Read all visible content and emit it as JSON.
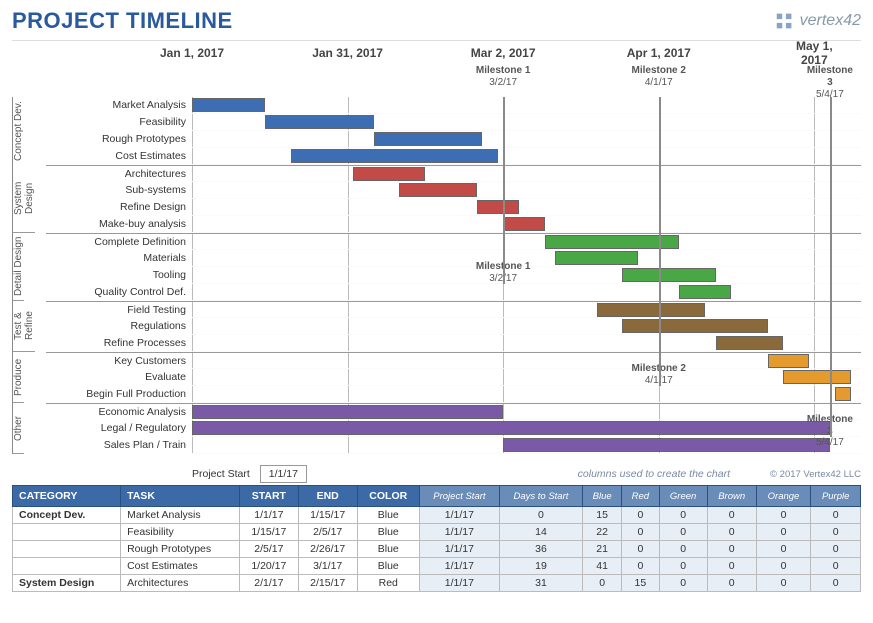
{
  "title": "PROJECT TIMELINE",
  "logo_text": "vertex42",
  "copyright": "© 2017 Vertex42 LLC",
  "project_start_label": "Project Start",
  "project_start_value": "1/1/17",
  "columns_hint": "columns used to create the chart",
  "colors": {
    "Blue": "#3d6db3",
    "Red": "#c24a47",
    "Green": "#4aa746",
    "Brown": "#8a6a3b",
    "Orange": "#e59a2e",
    "Purple": "#7a5aa6"
  },
  "chart_data": {
    "type": "gantt",
    "title": "PROJECT TIMELINE",
    "x_axis": {
      "start": "2017-01-01",
      "end": "2017-05-10",
      "ticks": [
        {
          "label": "Jan 1, 2017",
          "date": "2017-01-01"
        },
        {
          "label": "Jan 31, 2017",
          "date": "2017-01-31"
        },
        {
          "label": "Mar 2, 2017",
          "date": "2017-03-02"
        },
        {
          "label": "Apr 1, 2017",
          "date": "2017-04-01"
        },
        {
          "label": "May 1, 2017",
          "date": "2017-05-01"
        }
      ]
    },
    "milestones": [
      {
        "name": "Milestone 1",
        "date": "2017-03-02",
        "label": "3/2/17",
        "span_rows": [
          0,
          11
        ]
      },
      {
        "name": "Milestone 2",
        "date": "2017-04-01",
        "label": "4/1/17",
        "span_rows": [
          0,
          17
        ]
      },
      {
        "name": "Milestone 3",
        "date": "2017-05-04",
        "label": "5/4/17",
        "span_rows": [
          0,
          20
        ]
      }
    ],
    "milestone_callouts_lower": [
      {
        "name": "Milestone 1",
        "label": "3/2/17",
        "row_below": 10
      },
      {
        "name": "Milestone 2",
        "label": "4/1/17",
        "row_below": 16
      },
      {
        "name": "Milestone 3",
        "label": "5/4/17",
        "row_below": 19
      }
    ],
    "groups": [
      {
        "name": "Concept Dev.",
        "color": "Blue",
        "tasks": [
          {
            "name": "Market Analysis",
            "start": "2017-01-01",
            "end": "2017-01-15"
          },
          {
            "name": "Feasibility",
            "start": "2017-01-15",
            "end": "2017-02-05"
          },
          {
            "name": "Rough Prototypes",
            "start": "2017-02-05",
            "end": "2017-02-26"
          },
          {
            "name": "Cost Estimates",
            "start": "2017-01-20",
            "end": "2017-03-01"
          }
        ]
      },
      {
        "name": "System Design",
        "color": "Red",
        "tasks": [
          {
            "name": "Architectures",
            "start": "2017-02-01",
            "end": "2017-02-15"
          },
          {
            "name": "Sub-systems",
            "start": "2017-02-10",
            "end": "2017-02-25"
          },
          {
            "name": "Refine Design",
            "start": "2017-02-25",
            "end": "2017-03-05"
          },
          {
            "name": "Make-buy analysis",
            "start": "2017-03-02",
            "end": "2017-03-10"
          }
        ]
      },
      {
        "name": "Detail Design",
        "color": "Green",
        "tasks": [
          {
            "name": "Complete Definition",
            "start": "2017-03-10",
            "end": "2017-04-05"
          },
          {
            "name": "Materials",
            "start": "2017-03-12",
            "end": "2017-03-28"
          },
          {
            "name": "Tooling",
            "start": "2017-03-25",
            "end": "2017-04-12"
          },
          {
            "name": "Quality Control Def.",
            "start": "2017-04-05",
            "end": "2017-04-15"
          }
        ]
      },
      {
        "name": "Test & Refine",
        "color": "Brown",
        "tasks": [
          {
            "name": "Field Testing",
            "start": "2017-03-20",
            "end": "2017-04-10"
          },
          {
            "name": "Regulations",
            "start": "2017-03-25",
            "end": "2017-04-22"
          },
          {
            "name": "Refine Processes",
            "start": "2017-04-12",
            "end": "2017-04-25"
          }
        ]
      },
      {
        "name": "Produce",
        "color": "Orange",
        "tasks": [
          {
            "name": "Key Customers",
            "start": "2017-04-22",
            "end": "2017-04-30"
          },
          {
            "name": "Evaluate",
            "start": "2017-04-25",
            "end": "2017-05-08"
          },
          {
            "name": "Begin Full Production",
            "start": "2017-05-05",
            "end": "2017-05-08"
          }
        ]
      },
      {
        "name": "Other",
        "color": "Purple",
        "tasks": [
          {
            "name": "Economic Analysis",
            "start": "2017-01-01",
            "end": "2017-03-02"
          },
          {
            "name": "Legal / Regulatory",
            "start": "2017-01-01",
            "end": "2017-05-04"
          },
          {
            "name": "Sales Plan / Train",
            "start": "2017-03-02",
            "end": "2017-05-04"
          }
        ]
      }
    ]
  },
  "table": {
    "headers_main": [
      "CATEGORY",
      "TASK",
      "START",
      "END",
      "COLOR"
    ],
    "headers_sub": [
      "Project Start",
      "Days to Start",
      "Blue",
      "Red",
      "Green",
      "Brown",
      "Orange",
      "Purple"
    ],
    "rows": [
      {
        "category": "Concept Dev.",
        "task": "Market Analysis",
        "start": "1/1/17",
        "end": "1/15/17",
        "color": "Blue",
        "sub": [
          "1/1/17",
          "0",
          "15",
          "0",
          "0",
          "0",
          "0",
          "0"
        ]
      },
      {
        "category": "",
        "task": "Feasibility",
        "start": "1/15/17",
        "end": "2/5/17",
        "color": "Blue",
        "sub": [
          "1/1/17",
          "14",
          "22",
          "0",
          "0",
          "0",
          "0",
          "0"
        ]
      },
      {
        "category": "",
        "task": "Rough Prototypes",
        "start": "2/5/17",
        "end": "2/26/17",
        "color": "Blue",
        "sub": [
          "1/1/17",
          "36",
          "21",
          "0",
          "0",
          "0",
          "0",
          "0"
        ]
      },
      {
        "category": "",
        "task": "Cost Estimates",
        "start": "1/20/17",
        "end": "3/1/17",
        "color": "Blue",
        "sub": [
          "1/1/17",
          "19",
          "41",
          "0",
          "0",
          "0",
          "0",
          "0"
        ]
      },
      {
        "category": "System Design",
        "task": "Architectures",
        "start": "2/1/17",
        "end": "2/15/17",
        "color": "Red",
        "sub": [
          "1/1/17",
          "31",
          "0",
          "15",
          "0",
          "0",
          "0",
          "0"
        ]
      }
    ]
  }
}
